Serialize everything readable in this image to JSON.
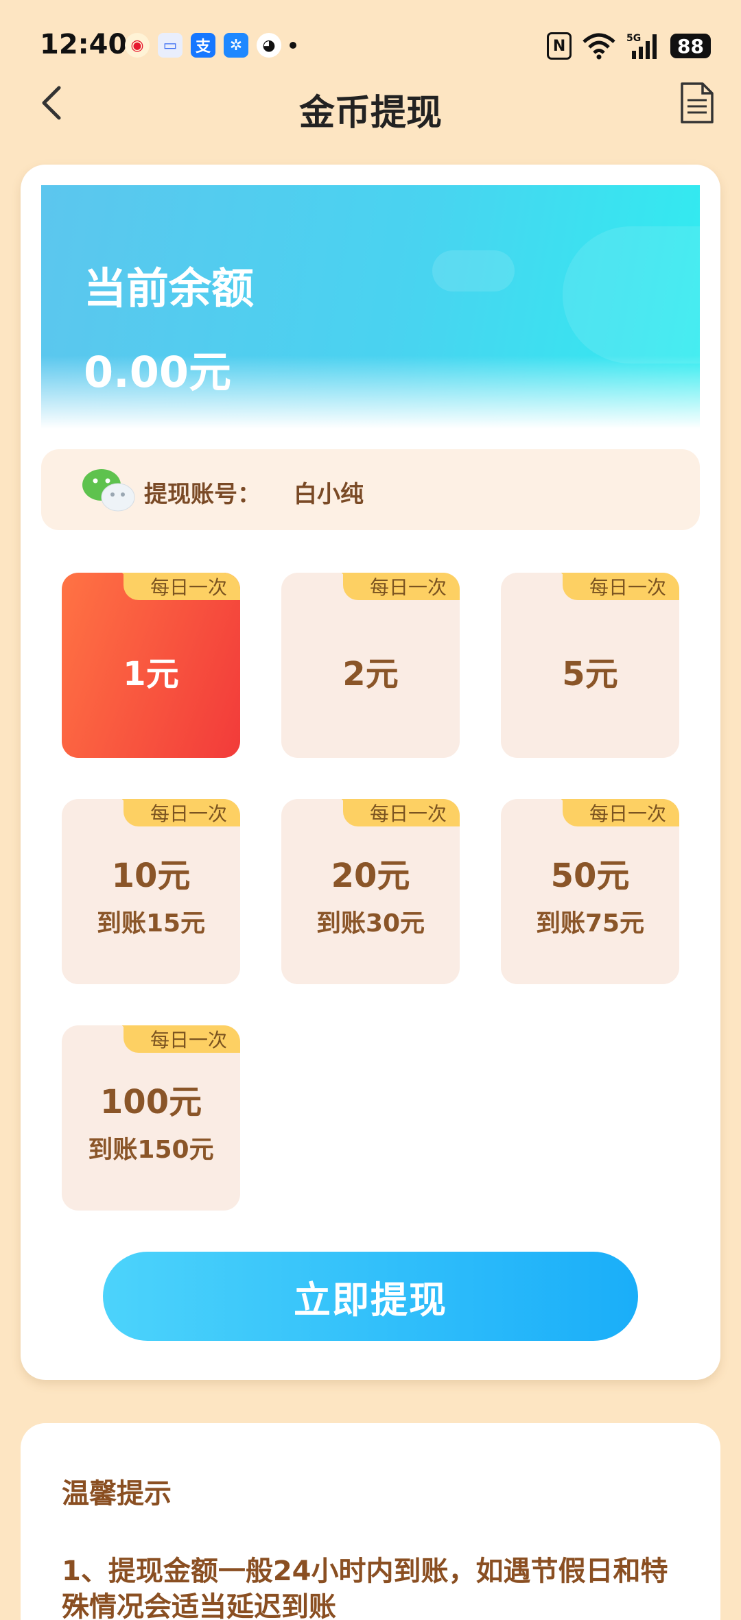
{
  "status_bar": {
    "time": "12:40",
    "notification_icons": [
      "weibo-icon",
      "message-icon",
      "alipay-icon",
      "fan-icon",
      "qq-icon"
    ],
    "battery": "88",
    "network": "5G"
  },
  "header": {
    "title": "金币提现"
  },
  "balance": {
    "label": "当前余额",
    "amount": "0.00元"
  },
  "account": {
    "label": "提现账号：",
    "name": "白小纯"
  },
  "options": [
    {
      "tag": "每日一次",
      "amount": "1元",
      "bonus": "",
      "selected": true
    },
    {
      "tag": "每日一次",
      "amount": "2元",
      "bonus": "",
      "selected": false
    },
    {
      "tag": "每日一次",
      "amount": "5元",
      "bonus": "",
      "selected": false
    },
    {
      "tag": "每日一次",
      "amount": "10元",
      "bonus": "到账15元",
      "selected": false
    },
    {
      "tag": "每日一次",
      "amount": "20元",
      "bonus": "到账30元",
      "selected": false
    },
    {
      "tag": "每日一次",
      "amount": "50元",
      "bonus": "到账75元",
      "selected": false
    },
    {
      "tag": "每日一次",
      "amount": "100元",
      "bonus": "到账150元",
      "selected": false
    }
  ],
  "withdraw_button": "立即提现",
  "tips": {
    "title": "温馨提示",
    "line1": "1、提现金额一般24小时内到账，如遇节假日和特殊情况会适当延迟到账"
  },
  "colors": {
    "page_bg": "#FDE5C2",
    "selected_option": "#F23B3A",
    "button": "#1AAEF9",
    "text_brown": "#8A5528"
  }
}
